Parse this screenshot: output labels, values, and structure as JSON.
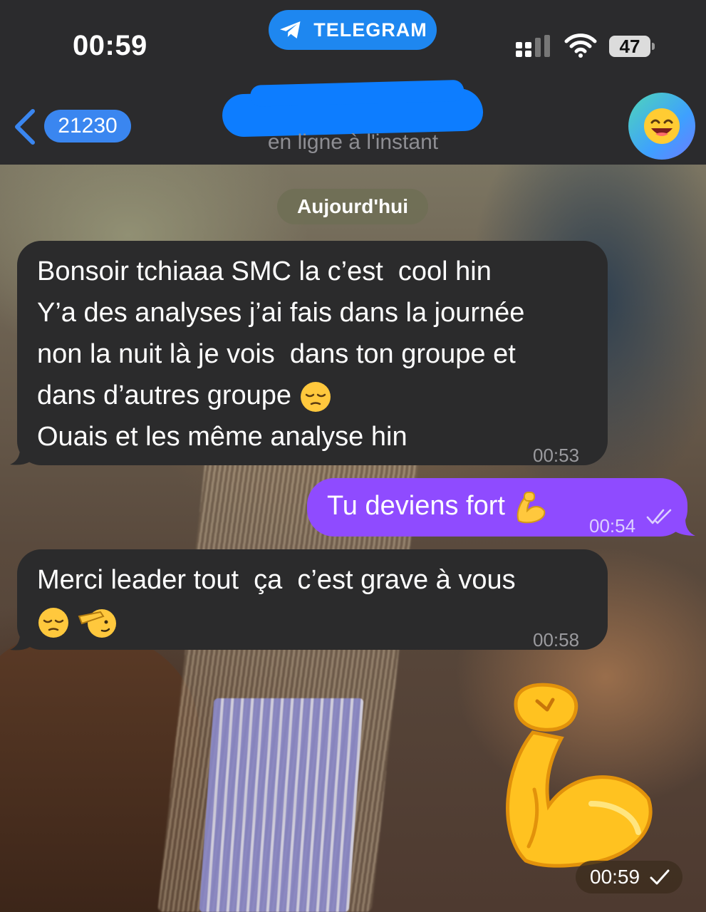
{
  "status_bar": {
    "time": "00:59",
    "app_pill": "TELEGRAM",
    "battery": "47"
  },
  "header": {
    "back_count": "21230",
    "presence": "en ligne à l'instant",
    "avatar_icon": "grinning-face-icon"
  },
  "chat": {
    "date_separator": "Aujourd'hui",
    "messages": [
      {
        "direction": "incoming",
        "lines": [
          "Bonsoir tchiaaa SMC la c’est  cool hin",
          "Y’a des analyses j’ai fais dans la journée",
          "non la nuit là je vois  dans ton groupe et",
          "dans d’autres groupe",
          "Ouais et les même analyse hin"
        ],
        "emoji": [
          "pensive-face"
        ],
        "time": "00:53"
      },
      {
        "direction": "outgoing",
        "text": "Tu deviens fort",
        "emoji": [
          "flexed-biceps"
        ],
        "time": "00:54",
        "status": "read"
      },
      {
        "direction": "incoming",
        "lines": [
          "Merci leader tout  ça  c’est grave à vous"
        ],
        "emoji": [
          "pensive-face",
          "saluting-face"
        ],
        "time": "00:58"
      },
      {
        "direction": "outgoing",
        "sticker": "flexed-biceps",
        "time": "00:59",
        "status": "sent"
      }
    ]
  },
  "colors": {
    "incoming_bubble": "#2b2b2c",
    "outgoing_bubble": "#8f4bff",
    "telegram_blue": "#1e87f0"
  }
}
